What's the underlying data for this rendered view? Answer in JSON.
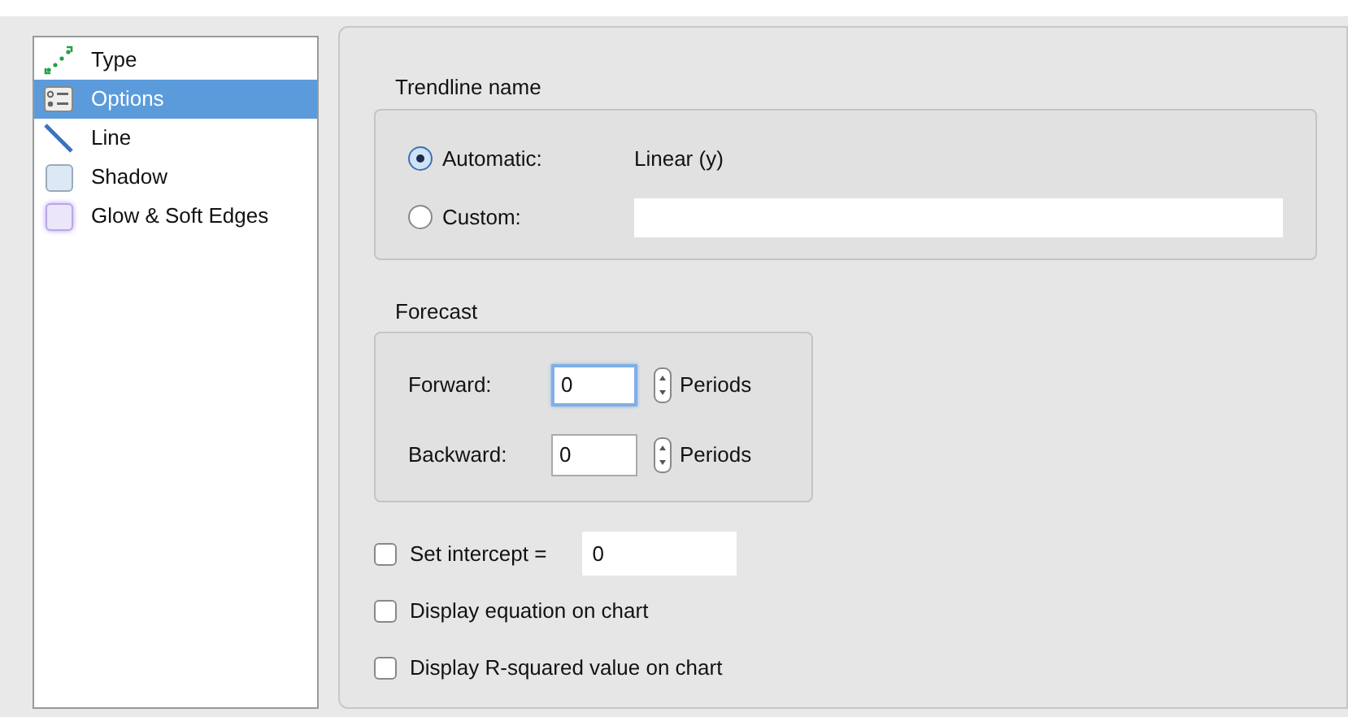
{
  "sidebar": {
    "items": [
      {
        "label": "Type",
        "kind": "type",
        "selected": false
      },
      {
        "label": "Options",
        "kind": "options",
        "selected": true
      },
      {
        "label": "Line",
        "kind": "line",
        "selected": false
      },
      {
        "label": "Shadow",
        "kind": "shadow",
        "selected": false
      },
      {
        "label": "Glow & Soft Edges",
        "kind": "glow",
        "selected": false
      }
    ]
  },
  "trendline_name": {
    "title": "Trendline name",
    "options": [
      {
        "label": "Automatic:",
        "selected": true,
        "value": "Linear (y)"
      },
      {
        "label": "Custom:",
        "selected": false
      }
    ]
  },
  "forecast": {
    "title": "Forecast",
    "rows": [
      {
        "label": "Forward:",
        "value": "0",
        "focused": true,
        "unit": "Periods"
      },
      {
        "label": "Backward:",
        "value": "0",
        "focused": false,
        "unit": "Periods"
      }
    ]
  },
  "checks": [
    {
      "label": "Set intercept =",
      "checked": false,
      "value": "0"
    },
    {
      "label": "Display equation on chart",
      "checked": false
    },
    {
      "label": "Display R-squared value on chart",
      "checked": false
    }
  ]
}
